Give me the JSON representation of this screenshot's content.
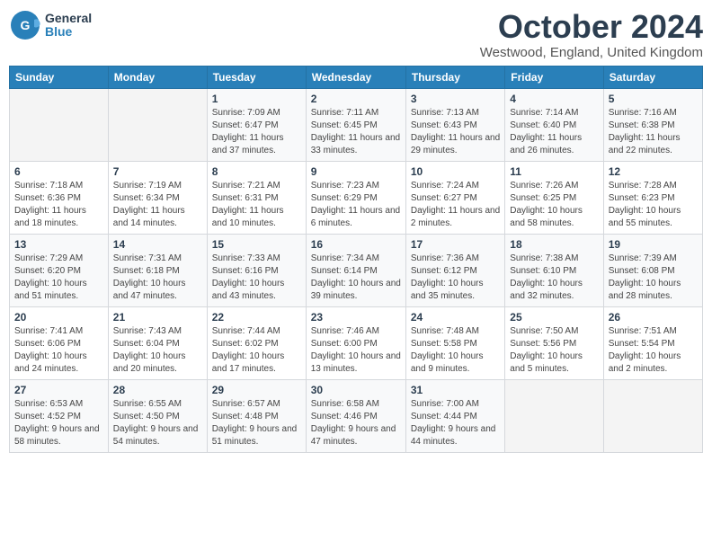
{
  "header": {
    "logo_general": "General",
    "logo_blue": "Blue",
    "month_title": "October 2024",
    "location": "Westwood, England, United Kingdom"
  },
  "weekdays": [
    "Sunday",
    "Monday",
    "Tuesday",
    "Wednesday",
    "Thursday",
    "Friday",
    "Saturday"
  ],
  "weeks": [
    [
      {
        "day": "",
        "info": ""
      },
      {
        "day": "",
        "info": ""
      },
      {
        "day": "1",
        "info": "Sunrise: 7:09 AM\nSunset: 6:47 PM\nDaylight: 11 hours and 37 minutes."
      },
      {
        "day": "2",
        "info": "Sunrise: 7:11 AM\nSunset: 6:45 PM\nDaylight: 11 hours and 33 minutes."
      },
      {
        "day": "3",
        "info": "Sunrise: 7:13 AM\nSunset: 6:43 PM\nDaylight: 11 hours and 29 minutes."
      },
      {
        "day": "4",
        "info": "Sunrise: 7:14 AM\nSunset: 6:40 PM\nDaylight: 11 hours and 26 minutes."
      },
      {
        "day": "5",
        "info": "Sunrise: 7:16 AM\nSunset: 6:38 PM\nDaylight: 11 hours and 22 minutes."
      }
    ],
    [
      {
        "day": "6",
        "info": "Sunrise: 7:18 AM\nSunset: 6:36 PM\nDaylight: 11 hours and 18 minutes."
      },
      {
        "day": "7",
        "info": "Sunrise: 7:19 AM\nSunset: 6:34 PM\nDaylight: 11 hours and 14 minutes."
      },
      {
        "day": "8",
        "info": "Sunrise: 7:21 AM\nSunset: 6:31 PM\nDaylight: 11 hours and 10 minutes."
      },
      {
        "day": "9",
        "info": "Sunrise: 7:23 AM\nSunset: 6:29 PM\nDaylight: 11 hours and 6 minutes."
      },
      {
        "day": "10",
        "info": "Sunrise: 7:24 AM\nSunset: 6:27 PM\nDaylight: 11 hours and 2 minutes."
      },
      {
        "day": "11",
        "info": "Sunrise: 7:26 AM\nSunset: 6:25 PM\nDaylight: 10 hours and 58 minutes."
      },
      {
        "day": "12",
        "info": "Sunrise: 7:28 AM\nSunset: 6:23 PM\nDaylight: 10 hours and 55 minutes."
      }
    ],
    [
      {
        "day": "13",
        "info": "Sunrise: 7:29 AM\nSunset: 6:20 PM\nDaylight: 10 hours and 51 minutes."
      },
      {
        "day": "14",
        "info": "Sunrise: 7:31 AM\nSunset: 6:18 PM\nDaylight: 10 hours and 47 minutes."
      },
      {
        "day": "15",
        "info": "Sunrise: 7:33 AM\nSunset: 6:16 PM\nDaylight: 10 hours and 43 minutes."
      },
      {
        "day": "16",
        "info": "Sunrise: 7:34 AM\nSunset: 6:14 PM\nDaylight: 10 hours and 39 minutes."
      },
      {
        "day": "17",
        "info": "Sunrise: 7:36 AM\nSunset: 6:12 PM\nDaylight: 10 hours and 35 minutes."
      },
      {
        "day": "18",
        "info": "Sunrise: 7:38 AM\nSunset: 6:10 PM\nDaylight: 10 hours and 32 minutes."
      },
      {
        "day": "19",
        "info": "Sunrise: 7:39 AM\nSunset: 6:08 PM\nDaylight: 10 hours and 28 minutes."
      }
    ],
    [
      {
        "day": "20",
        "info": "Sunrise: 7:41 AM\nSunset: 6:06 PM\nDaylight: 10 hours and 24 minutes."
      },
      {
        "day": "21",
        "info": "Sunrise: 7:43 AM\nSunset: 6:04 PM\nDaylight: 10 hours and 20 minutes."
      },
      {
        "day": "22",
        "info": "Sunrise: 7:44 AM\nSunset: 6:02 PM\nDaylight: 10 hours and 17 minutes."
      },
      {
        "day": "23",
        "info": "Sunrise: 7:46 AM\nSunset: 6:00 PM\nDaylight: 10 hours and 13 minutes."
      },
      {
        "day": "24",
        "info": "Sunrise: 7:48 AM\nSunset: 5:58 PM\nDaylight: 10 hours and 9 minutes."
      },
      {
        "day": "25",
        "info": "Sunrise: 7:50 AM\nSunset: 5:56 PM\nDaylight: 10 hours and 5 minutes."
      },
      {
        "day": "26",
        "info": "Sunrise: 7:51 AM\nSunset: 5:54 PM\nDaylight: 10 hours and 2 minutes."
      }
    ],
    [
      {
        "day": "27",
        "info": "Sunrise: 6:53 AM\nSunset: 4:52 PM\nDaylight: 9 hours and 58 minutes."
      },
      {
        "day": "28",
        "info": "Sunrise: 6:55 AM\nSunset: 4:50 PM\nDaylight: 9 hours and 54 minutes."
      },
      {
        "day": "29",
        "info": "Sunrise: 6:57 AM\nSunset: 4:48 PM\nDaylight: 9 hours and 51 minutes."
      },
      {
        "day": "30",
        "info": "Sunrise: 6:58 AM\nSunset: 4:46 PM\nDaylight: 9 hours and 47 minutes."
      },
      {
        "day": "31",
        "info": "Sunrise: 7:00 AM\nSunset: 4:44 PM\nDaylight: 9 hours and 44 minutes."
      },
      {
        "day": "",
        "info": ""
      },
      {
        "day": "",
        "info": ""
      }
    ]
  ]
}
